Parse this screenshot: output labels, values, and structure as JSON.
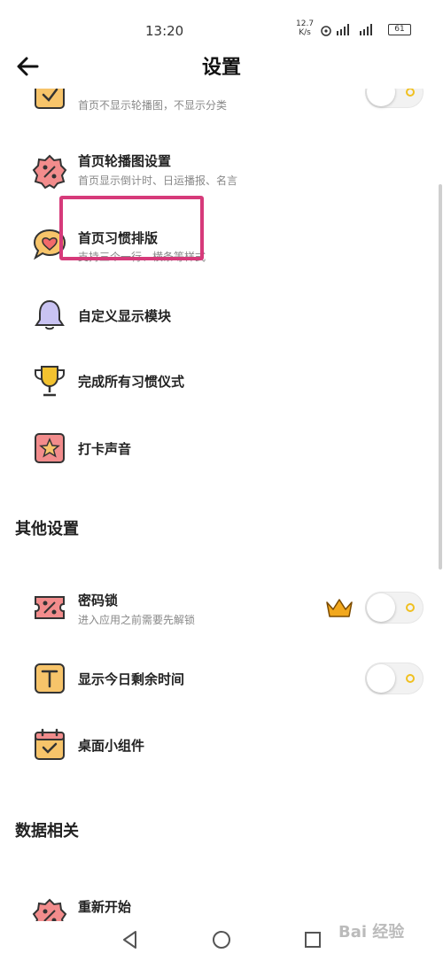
{
  "status_bar": {
    "time": "13:20",
    "speed_value": "12.7",
    "speed_unit": "K/s",
    "battery": "61"
  },
  "header": {
    "title": "设置",
    "back_icon": "arrow-left-icon"
  },
  "partial_item": {
    "subtitle": "首页不显示轮播图，不显示分类",
    "icon": "checkbox-icon"
  },
  "items": [
    {
      "title": "首页轮播图设置",
      "subtitle": "首页显示倒计时、日运播报、名言",
      "icon": "percent-badge-icon"
    },
    {
      "title": "首页习惯排版",
      "subtitle": "支持三个一行、横条等样式",
      "icon": "heart-chat-icon"
    },
    {
      "title": "自定义显示模块",
      "icon": "bell-icon"
    },
    {
      "title": "完成所有习惯仪式",
      "icon": "trophy-icon"
    },
    {
      "title": "打卡声音",
      "icon": "star-icon"
    }
  ],
  "sections": {
    "other": "其他设置",
    "data": "数据相关"
  },
  "other_items": [
    {
      "title": "密码锁",
      "subtitle": "进入应用之前需要先解锁",
      "icon": "percent-ticket-icon",
      "premium_icon": "crown-icon"
    },
    {
      "title": "显示今日剩余时间",
      "icon": "text-t-icon"
    },
    {
      "title": "桌面小组件",
      "icon": "calendar-check-icon"
    }
  ],
  "data_items": [
    {
      "title": "重新开始",
      "icon": "percent-badge-icon"
    }
  ],
  "watermark": "Bai 经验",
  "colors": {
    "icon_orange": "#f7c46a",
    "icon_pink": "#f28c8c",
    "icon_purple": "#c9c3f2",
    "icon_gold": "#f2c230",
    "highlight": "#d63a7a",
    "toggle_dot": "#f0c020"
  }
}
